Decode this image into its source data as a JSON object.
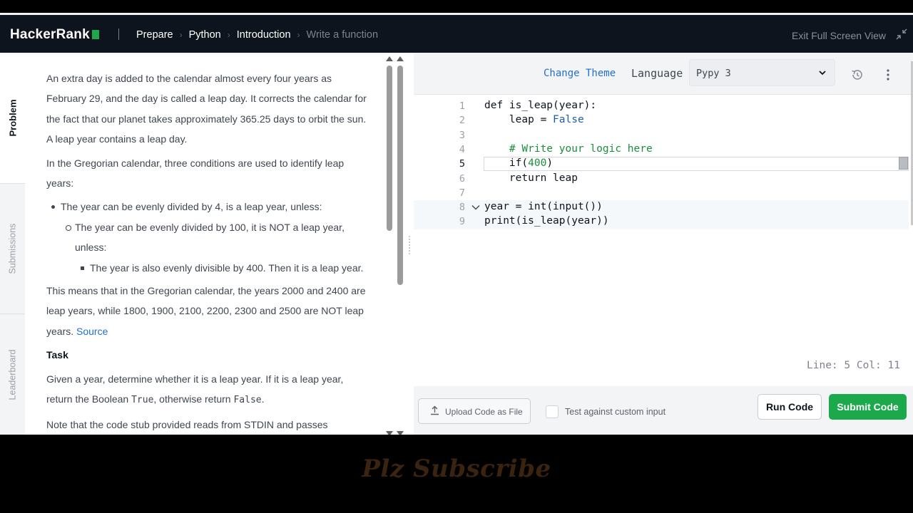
{
  "header": {
    "logo_text": "HackerRank",
    "breadcrumb": [
      "Prepare",
      "Python",
      "Introduction",
      "Write a function"
    ],
    "exit_full_screen": "Exit Full Screen View"
  },
  "sidebar": {
    "tabs": [
      {
        "label": "Problem",
        "active": true
      },
      {
        "label": "Submissions",
        "active": false
      },
      {
        "label": "Leaderboard",
        "active": false
      }
    ]
  },
  "problem": {
    "p1": "An extra day is added to the calendar almost every four years as February 29, and the day is called a leap day. It corrects the calendar for the fact that our planet takes approximately 365.25 days to orbit the sun. A leap year contains a leap day.",
    "p2": "In the Gregorian calendar, three conditions are used to identify leap years:",
    "bullet1": "The year can be evenly divided by 4, is a leap year, unless:",
    "bullet2": "The year can be evenly divided by 100, it is NOT a leap year, unless:",
    "bullet3": "The year is also evenly divisible by 400. Then it is a leap year.",
    "p3": "This means that in the Gregorian calendar, the years 2000 and 2400 are leap years, while 1800, 1900, 2100, 2200, 2300 and 2500 are NOT leap years.",
    "source_link": "Source",
    "task_heading": "Task",
    "task_text_1": "Given a year, determine whether it is a leap year. If it is a leap year, return the Boolean",
    "task_true": "True",
    "task_text_2": ", otherwise return",
    "task_false": "False",
    "task_text_3": ".",
    "note": "Note that the code stub provided reads from STDIN and passes"
  },
  "editor": {
    "change_theme": "Change Theme",
    "language_label": "Language",
    "language_value": "Pypy 3",
    "lines": [
      "1",
      "2",
      "3",
      "4",
      "5",
      "6",
      "7",
      "8",
      "9"
    ],
    "code": {
      "l1": "def is_leap(year):",
      "l2a": "    leap = ",
      "l2b": "False",
      "l4": "    # Write your logic here",
      "l5a": "    if(",
      "l5b": "400",
      "l5c": ")",
      "l6": "    return leap",
      "l8": "year = int(input())",
      "l9": "print(is_leap(year))"
    },
    "cursor_info": "Line: 5 Col: 11"
  },
  "actions": {
    "upload": "Upload Code as File",
    "custom_input": "Test against custom input",
    "run": "Run Code",
    "submit": "Submit Code"
  },
  "overlay": {
    "watermark": "Plz Subscribe"
  },
  "colors": {
    "navbar": "#0e141e",
    "brand_green": "#1ba94c",
    "link_blue": "#1f6fd1",
    "comment_green": "#1a8f3c"
  }
}
